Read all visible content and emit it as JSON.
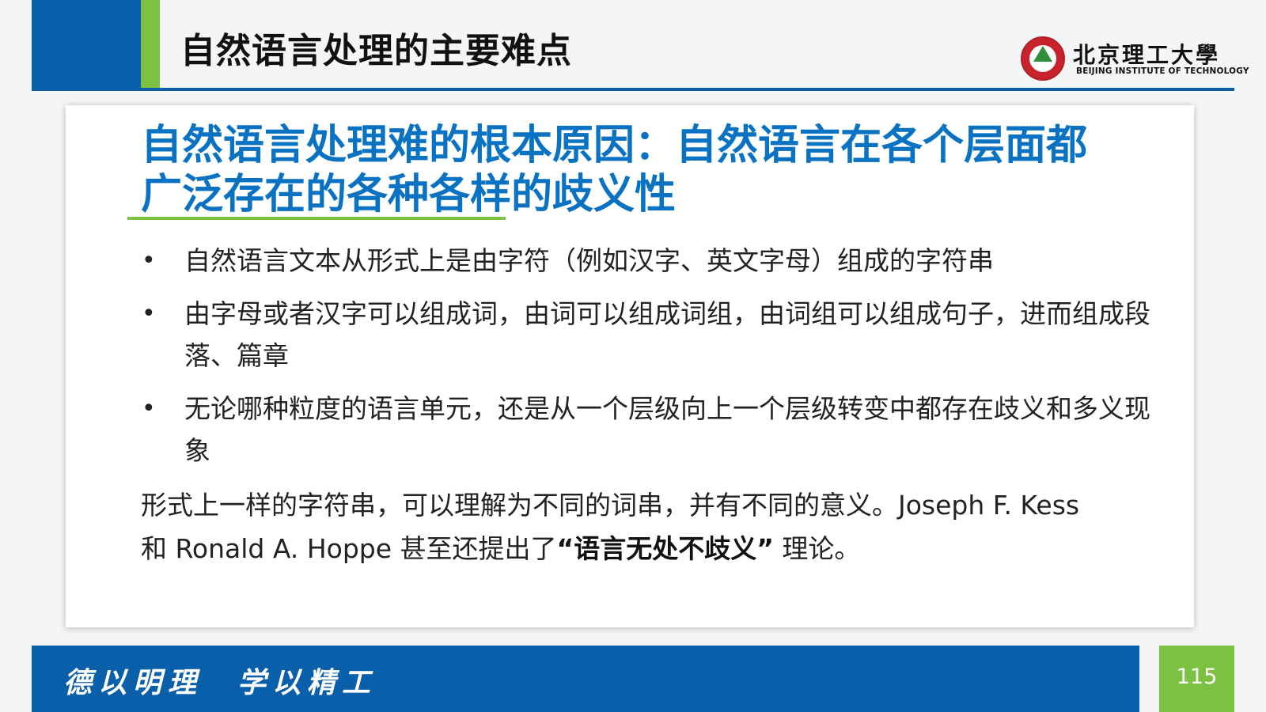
{
  "header": {
    "title": "自然语言处理的主要难点"
  },
  "logo": {
    "name_cn": "北京理工大學",
    "name_en": "BEIJING INSTITUTE OF TECHNOLOGY"
  },
  "content": {
    "subtitle": "自然语言处理难的根本原因：自然语言在各个层面都广泛存在的各种各样的歧义性",
    "bullet_marker": "•",
    "bullets": [
      "自然语言文本从形式上是由字符（例如汉字、英文字母）组成的字符串",
      "由字母或者汉字可以组成词，由词可以组成词组，由词组可以组成句子，进而组成段落、篇章",
      "无论哪种粒度的语言单元，还是从一个层级向上一个层级转变中都存在歧义和多义现象"
    ],
    "paragraph": {
      "text_before": "形式上一样的字符串，可以理解为不同的词串，并有不同的意义。Joseph F. Kess 和 Ronald A. Hoppe 甚至还提出了",
      "emphasis": "“语言无处不歧义”",
      "text_after": " 理论。"
    }
  },
  "footer": {
    "motto": "德以明理　学以精工",
    "page_number": "115"
  },
  "colors": {
    "primary_blue": "#0a5faa",
    "subtitle_blue": "#0a72c2",
    "accent_green": "#7dc143",
    "logo_red": "#c8232c"
  }
}
